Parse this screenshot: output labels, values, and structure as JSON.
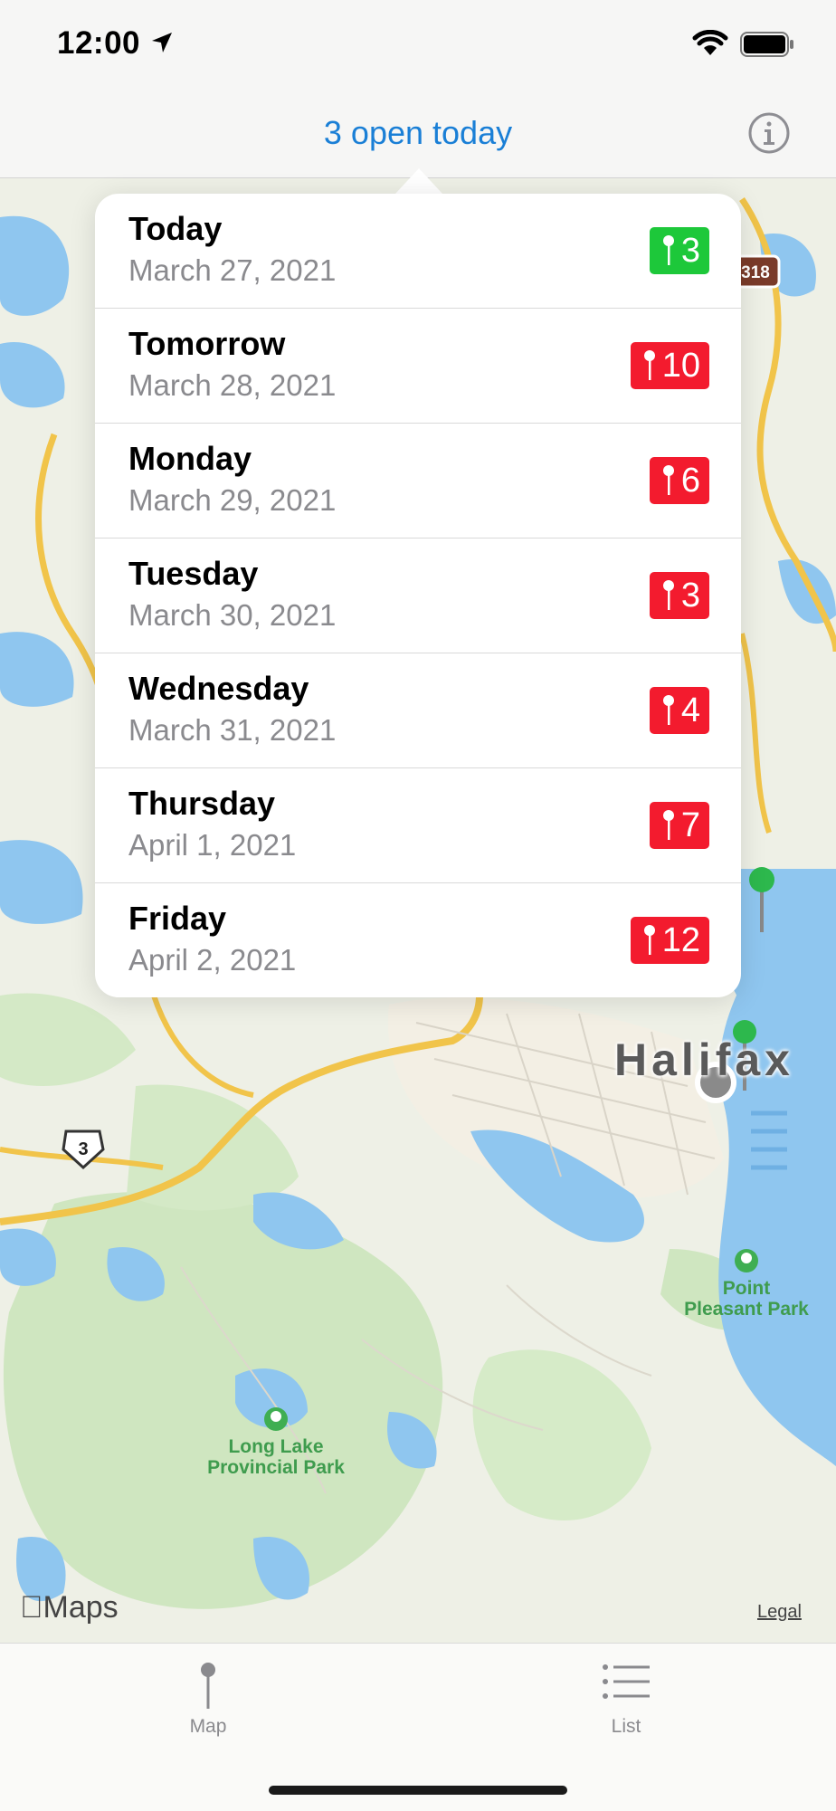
{
  "status": {
    "time": "12:00"
  },
  "nav": {
    "title": "3 open today"
  },
  "days": [
    {
      "name": "Today",
      "date": "March 27, 2021",
      "count": "3",
      "color": "#1dc83a",
      "kind": "green"
    },
    {
      "name": "Tomorrow",
      "date": "March 28, 2021",
      "count": "10",
      "color": "#f31b2e",
      "kind": "red"
    },
    {
      "name": "Monday",
      "date": "March 29, 2021",
      "count": "6",
      "color": "#f31b2e",
      "kind": "red"
    },
    {
      "name": "Tuesday",
      "date": "March 30, 2021",
      "count": "3",
      "color": "#f31b2e",
      "kind": "red"
    },
    {
      "name": "Wednesday",
      "date": "March 31, 2021",
      "count": "4",
      "color": "#f31b2e",
      "kind": "red"
    },
    {
      "name": "Thursday",
      "date": "April 1, 2021",
      "count": "7",
      "color": "#f31b2e",
      "kind": "red"
    },
    {
      "name": "Friday",
      "date": "April 2, 2021",
      "count": "12",
      "color": "#f31b2e",
      "kind": "red"
    }
  ],
  "map": {
    "city_label": "Halifax",
    "park1": "Point Pleasant Park",
    "park1_line1": "Point",
    "park1_line2": "Pleasant Park",
    "park2_line1": "Long Lake",
    "park2_line2": "Provincial Park",
    "highway_3": "3",
    "highway_318": "318",
    "maps_logo": "Maps",
    "legal": "Legal"
  },
  "tabs": [
    {
      "label": "Map",
      "icon": "pin-icon"
    },
    {
      "label": "List",
      "icon": "list-icon"
    }
  ]
}
